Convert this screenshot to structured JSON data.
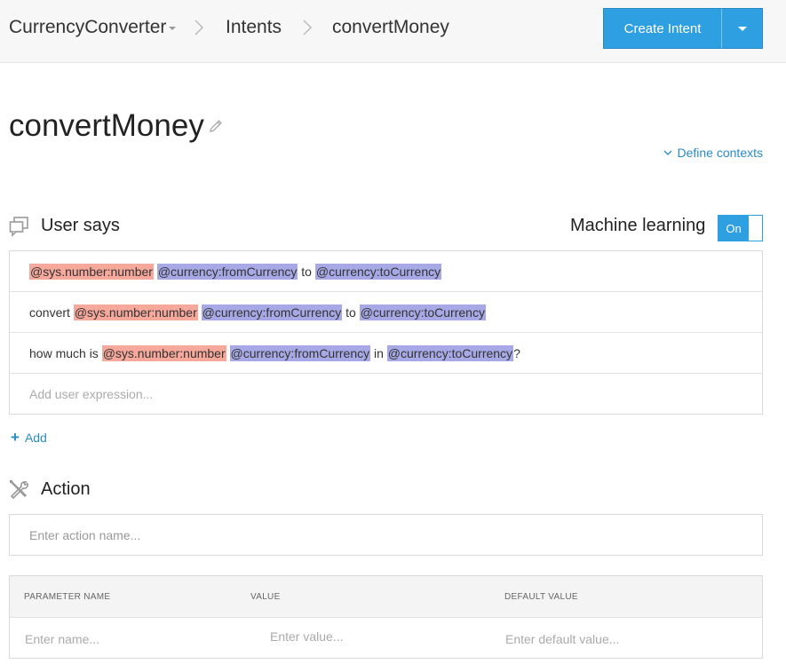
{
  "header": {
    "agent_name": "CurrencyConverter",
    "breadcrumb_intents": "Intents",
    "breadcrumb_current": "convertMoney",
    "create_button_label": "Create Intent"
  },
  "intent": {
    "title": "convertMoney",
    "define_contexts_label": "Define contexts"
  },
  "user_says": {
    "heading": "User says",
    "ml_label": "Machine learning",
    "ml_toggle_label": "On",
    "expressions": [
      {
        "parts": [
          {
            "text": "@sys.number:number",
            "type": "sys"
          },
          {
            "text": " ",
            "type": "plain"
          },
          {
            "text": "@currency:fromCurrency",
            "type": "cur"
          },
          {
            "text": " to ",
            "type": "plain"
          },
          {
            "text": "@currency:toCurrency",
            "type": "cur"
          }
        ]
      },
      {
        "parts": [
          {
            "text": "convert ",
            "type": "plain"
          },
          {
            "text": "@sys.number:number",
            "type": "sys"
          },
          {
            "text": " ",
            "type": "plain"
          },
          {
            "text": "@currency:fromCurrency",
            "type": "cur"
          },
          {
            "text": " to ",
            "type": "plain"
          },
          {
            "text": "@currency:toCurrency",
            "type": "cur"
          }
        ]
      },
      {
        "parts": [
          {
            "text": "how much is ",
            "type": "plain"
          },
          {
            "text": "@sys.number:number",
            "type": "sys"
          },
          {
            "text": " ",
            "type": "plain"
          },
          {
            "text": "@currency:fromCurrency",
            "type": "cur"
          },
          {
            "text": " in ",
            "type": "plain"
          },
          {
            "text": "@currency:toCurrency",
            "type": "cur"
          },
          {
            "text": "?",
            "type": "plain"
          }
        ]
      }
    ],
    "input_placeholder": "Add user expression...",
    "add_label": "Add"
  },
  "action": {
    "heading": "Action",
    "input_placeholder": "Enter action name...",
    "columns": [
      "PARAMETER NAME",
      "VALUE",
      "DEFAULT VALUE"
    ],
    "name_placeholder": "Enter name...",
    "value_placeholder": "Enter value...",
    "default_placeholder": "Enter default value..."
  },
  "colors": {
    "accent": "#2e9fe0",
    "link": "#2a8bc9",
    "sys_entity": "#f6a89b",
    "custom_entity": "#a7a9e6"
  }
}
